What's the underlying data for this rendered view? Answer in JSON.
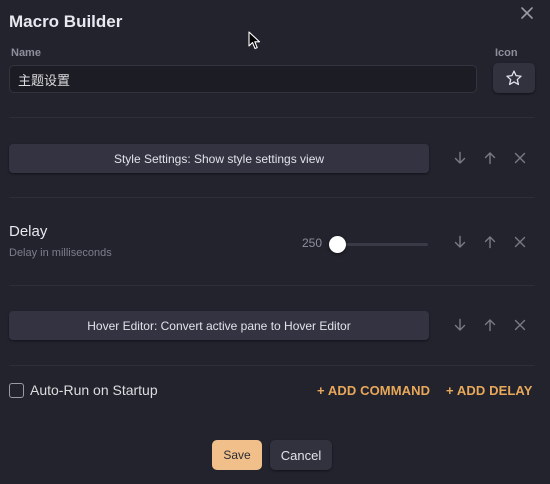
{
  "modal": {
    "title": "Macro Builder",
    "close_icon": "close-icon"
  },
  "name_field": {
    "label": "Name",
    "value": "主题设置"
  },
  "icon_field": {
    "label": "Icon",
    "icon": "star-icon"
  },
  "commands": [
    {
      "type": "command",
      "label": "Style Settings: Show style settings view"
    },
    {
      "type": "delay",
      "title": "Delay",
      "description": "Delay in milliseconds",
      "value": "250",
      "slider_fraction": 0.0
    },
    {
      "type": "command",
      "label": "Hover Editor: Convert active pane to Hover Editor"
    }
  ],
  "row_actions": [
    "arrow-down-icon",
    "arrow-up-icon",
    "remove-icon"
  ],
  "footer": {
    "autorun_label": "Auto-Run on Startup",
    "autorun_checked": false,
    "add_command": "+ ADD COMMAND",
    "add_delay": "+ ADD DELAY"
  },
  "buttons": {
    "save": "Save",
    "cancel": "Cancel"
  },
  "colors": {
    "background": "#23232e",
    "accent": "#e8a85a",
    "save_button": "#f1c08a"
  }
}
